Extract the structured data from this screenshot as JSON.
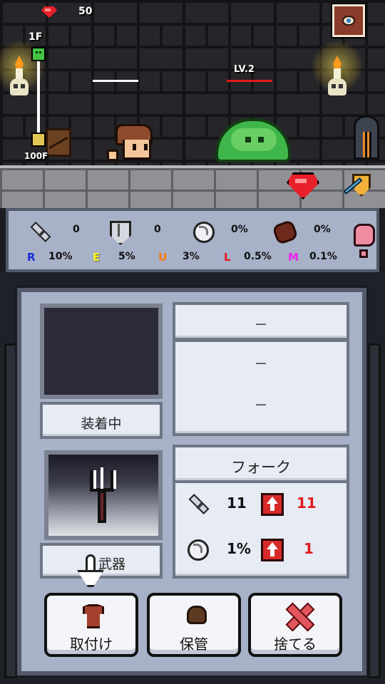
{
  "hud": {
    "gems": "50",
    "floor_current": "1F",
    "floor_target": "100F",
    "enemy_level": "LV.2"
  },
  "stats": {
    "attack": "0",
    "defense": "0",
    "critical": "0%",
    "food": "0%"
  },
  "rarity": [
    {
      "letter": "R",
      "value": "10%",
      "color": "#1a2bd6"
    },
    {
      "letter": "E",
      "value": "5%",
      "color": "#ffee22"
    },
    {
      "letter": "U",
      "value": "3%",
      "color": "#ff7a10"
    },
    {
      "letter": "L",
      "value": "0.5%",
      "color": "#e01b1b"
    },
    {
      "letter": "M",
      "value": "0.1%",
      "color": "#ee22ee"
    }
  ],
  "equipped": {
    "status_label": "装着中",
    "name": "－",
    "line1": "－",
    "line2": "－"
  },
  "item": {
    "name": "フォーク",
    "attack": "11",
    "attack_diff": "11",
    "critical": "1%",
    "critical_diff": "1",
    "category_label": "武器"
  },
  "actions": {
    "equip": "取付け",
    "store": "保管",
    "discard": "捨てる"
  },
  "icons": [
    "gem-icon",
    "book-icon",
    "sword-icon",
    "shield-icon",
    "critical-icon",
    "food-icon",
    "help-icon",
    "up-arrow-icon",
    "armor-icon",
    "bag-icon",
    "x-icon",
    "pointer-hand-icon"
  ]
}
